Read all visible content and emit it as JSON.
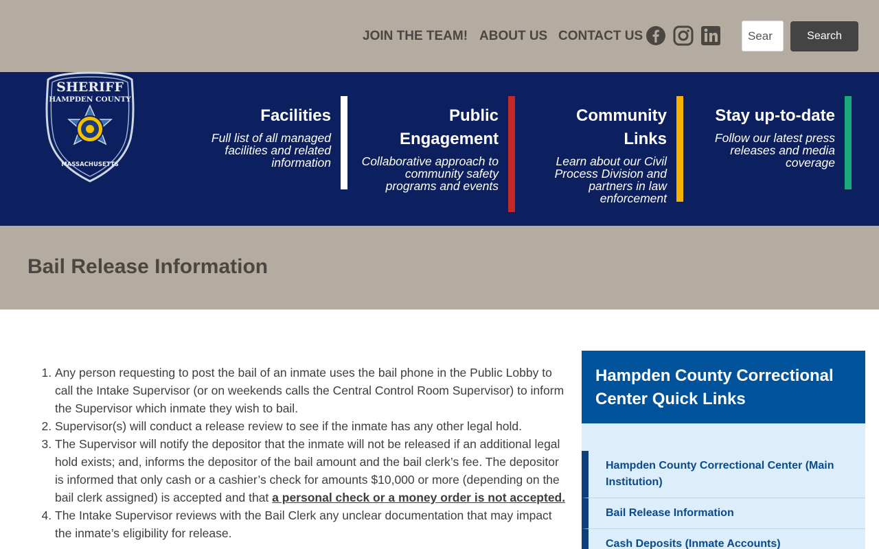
{
  "topnav": {
    "items": [
      "JOIN THE TEAM!",
      "ABOUT US",
      "CONTACT US"
    ],
    "social": [
      "facebook-icon",
      "instagram-icon",
      "linkedin-icon"
    ],
    "search_value": "Sear",
    "search_button": "Search"
  },
  "logo": {
    "top_text": "SHERIFF",
    "arc_text": "HAMPDEN COUNTY",
    "bottom_text": "MASSACHUSETTS"
  },
  "features": [
    {
      "title": "Facilities",
      "desc": "Full list of all managed facilities and related information",
      "color": "#ffffff"
    },
    {
      "title": "Public Engagement",
      "desc": "Collaborative approach to community safety programs and events",
      "color": "#c62828"
    },
    {
      "title": "Community Links",
      "desc": "Learn about our Civil Process Division and partners in law enforcement",
      "color": "#f5b300"
    },
    {
      "title": "Stay up-to-date",
      "desc": "Follow our latest press releases and media coverage",
      "color": "#1aa97a"
    }
  ],
  "page": {
    "title": "Bail Release Information"
  },
  "content": {
    "items": [
      "Any person requesting to post the bail of an inmate uses the bail phone in the Public Lobby to call the Intake Supervisor (or on weekends calls the Central Control Room Supervisor) to inform the Supervisor which inmate they wish to bail.",
      "Supervisor(s) will conduct a release review to see if the inmate has any other legal hold.",
      "The Supervisor will notify the depositor that the inmate will not be released if an additional legal hold exists; and, informs the depositor of the bail amount and the bail clerk’s fee.  The depositor is informed that only cash or a cashier’s check for amounts $10,000 or more (depending on the bail clerk assigned) is accepted and that ",
      "The Intake Supervisor reviews with the Bail Clerk any unclear documentation that may impact the inmate’s eligibility for release."
    ],
    "item3_emphasis": "a personal check or a money order is not accepted."
  },
  "sidebar": {
    "title": "Hampden County Correctional Center Quick Links",
    "links": [
      "Hampden County Correctional Center (Main Institution)",
      "Bail Release Information",
      "Cash Deposits (Inmate Accounts)"
    ]
  },
  "colors": {
    "topbar": "#b5aca1",
    "band": "#0c1f5e",
    "sidebar_head": "#00539b",
    "sidebar_bg": "#dcedfb"
  }
}
